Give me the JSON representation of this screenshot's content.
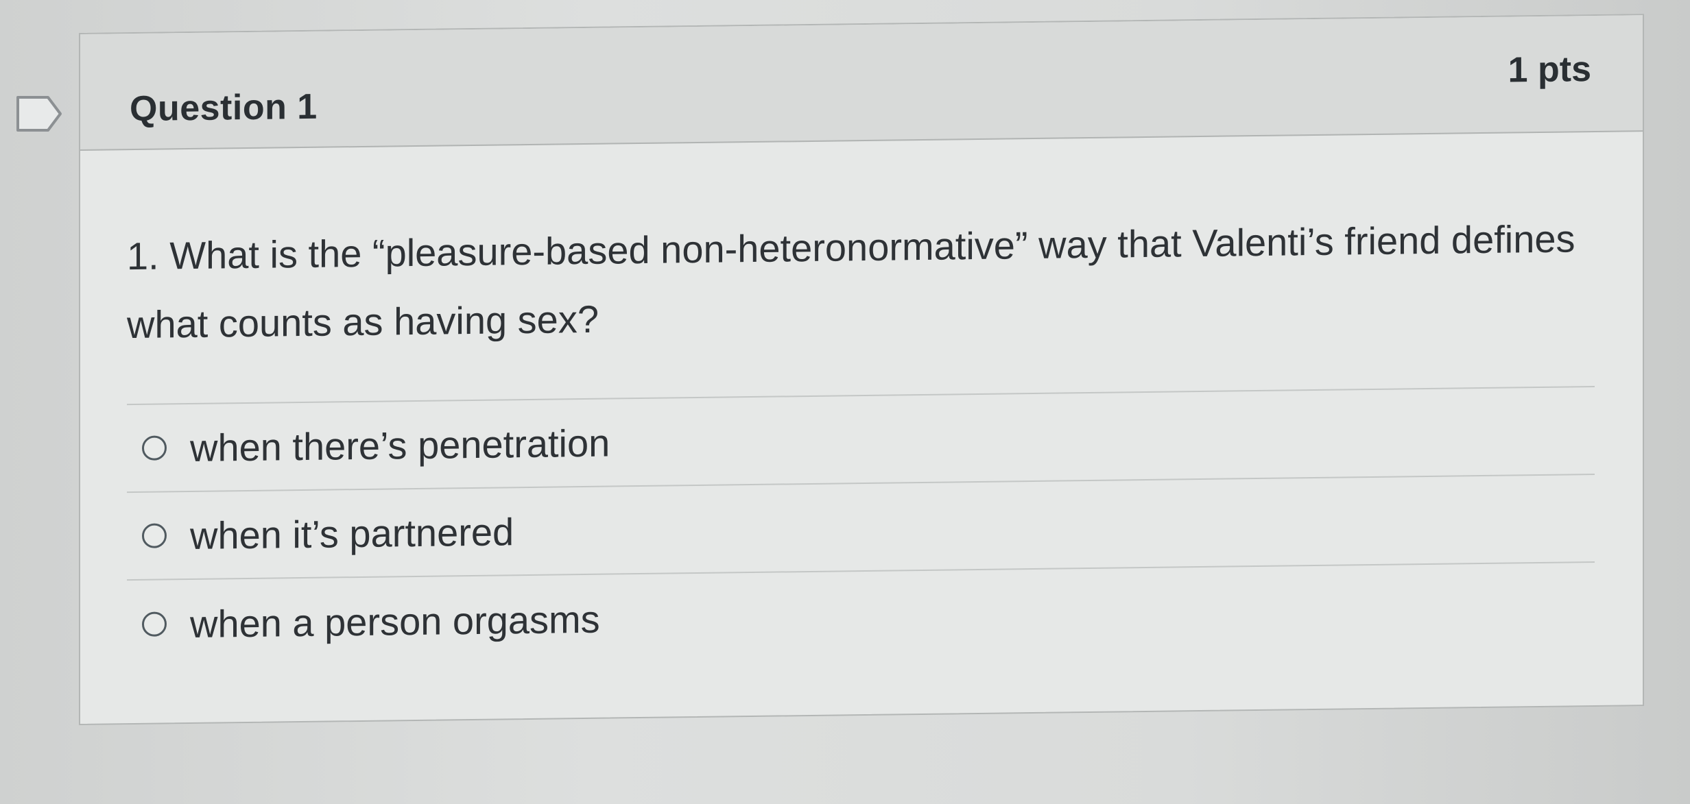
{
  "question": {
    "title": "Question 1",
    "points": "1 pts",
    "text": "1. What is the “pleasure-based non-heteronormative” way that Valenti’s friend defines what counts as having sex?",
    "answers": [
      {
        "label": "when there’s penetration"
      },
      {
        "label": "when it’s partnered"
      },
      {
        "label": "when a person orgasms"
      }
    ]
  },
  "icons": {
    "flag": "bookmark-flag-icon",
    "radio": "radio-button-icon"
  },
  "colors": {
    "text": "#2e3236",
    "header_bg": "#d8dad9",
    "card_bg": "#e6e8e7",
    "border": "#b3b6b5"
  }
}
